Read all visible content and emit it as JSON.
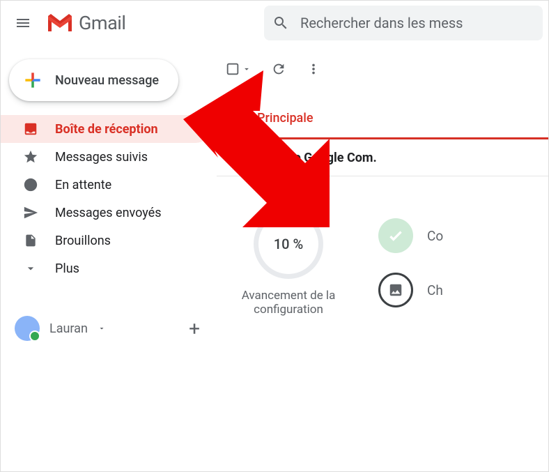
{
  "header": {
    "app_name": "Gmail",
    "search_placeholder": "Rechercher dans les mess"
  },
  "sidebar": {
    "compose_label": "Nouveau message",
    "items": [
      {
        "label": "Boîte de réception"
      },
      {
        "label": "Messages suivis"
      },
      {
        "label": "En attente"
      },
      {
        "label": "Messages envoyés"
      },
      {
        "label": "Brouillons"
      },
      {
        "label": "Plus"
      }
    ],
    "hangouts_user": "Lauran"
  },
  "main": {
    "tab_primary": "Principale",
    "mail_sender": "L'équipe Google Com.",
    "setup": {
      "progress_percent": "10 %",
      "progress_label": "Avancement de la configuration",
      "step_done": "Co",
      "step_theme": "Ch"
    }
  }
}
